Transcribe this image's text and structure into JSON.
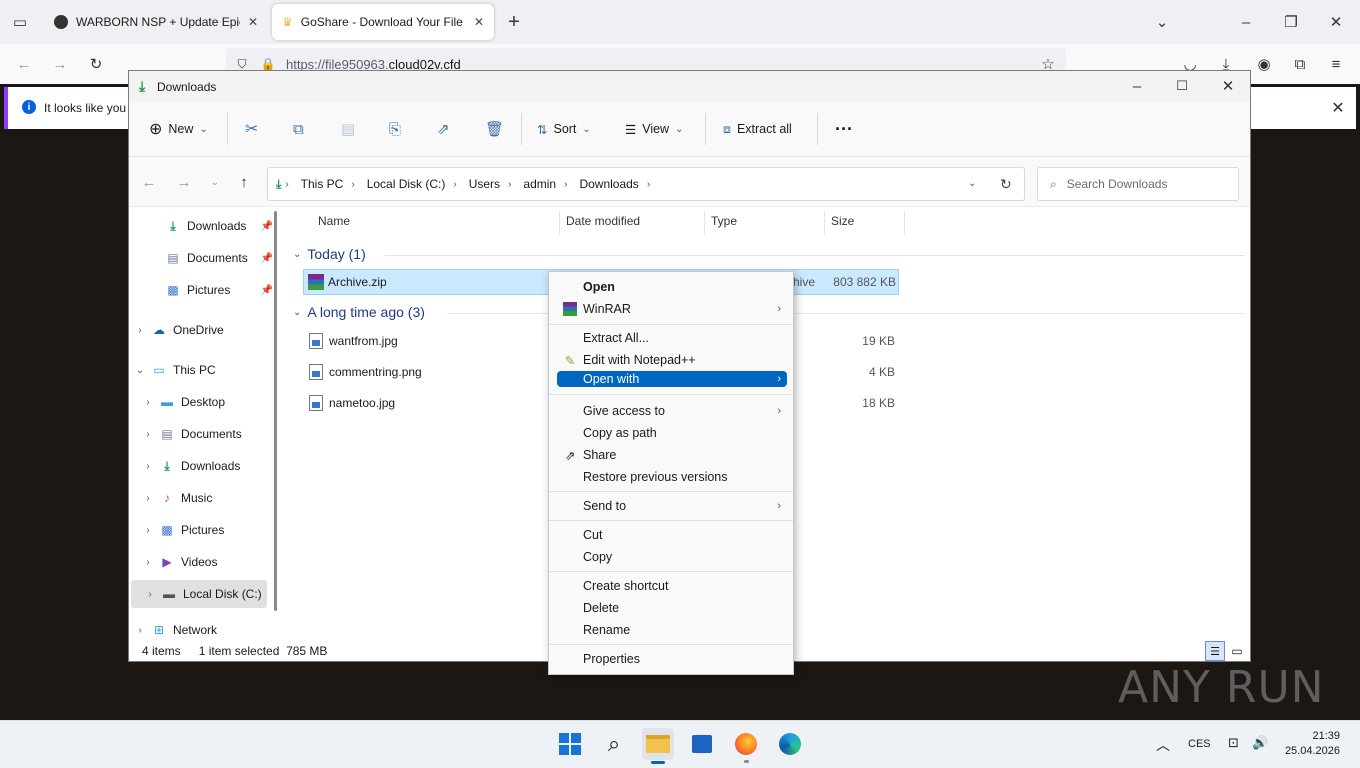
{
  "colors": {
    "accent": "#0067c0",
    "selection": "#cce8ff",
    "infobar_accent": "#8f3dfe"
  },
  "browser": {
    "tabs": [
      {
        "title": "WARBORN NSP + Update Epic N",
        "icon": "game-icon"
      },
      {
        "title": "GoShare - Download Your File",
        "icon": "crown-icon"
      }
    ],
    "url_prefix": "https://file950963.",
    "url_domain": "cloud02v.cfd",
    "infobar_text": "It looks like you h"
  },
  "explorer": {
    "title": "Downloads",
    "toolbar": {
      "new": "New",
      "sort": "Sort",
      "view": "View",
      "extract_all": "Extract all"
    },
    "breadcrumb": [
      "This PC",
      "Local Disk (C:)",
      "Users",
      "admin",
      "Downloads"
    ],
    "search_placeholder": "Search Downloads",
    "nav": {
      "quick": [
        {
          "label": "Downloads",
          "icon": "download-arrow-icon"
        },
        {
          "label": "Documents",
          "icon": "document-icon"
        },
        {
          "label": "Pictures",
          "icon": "picture-icon"
        }
      ],
      "onedrive": "OneDrive",
      "this_pc": "This PC",
      "pc_items": [
        "Desktop",
        "Documents",
        "Downloads",
        "Music",
        "Pictures",
        "Videos",
        "Local Disk (C:)"
      ],
      "network": "Network"
    },
    "columns": {
      "name": "Name",
      "date": "Date modified",
      "type": "Type",
      "size": "Size"
    },
    "groups": {
      "today": "Today (1)",
      "long_ago": "A long time ago (3)"
    },
    "files_today": [
      {
        "name": "Archive.zip",
        "type_partial": "hive",
        "size": "803 882 KB"
      }
    ],
    "files_old": [
      {
        "name": "wantfrom.jpg",
        "size": "19 KB"
      },
      {
        "name": "commentring.png",
        "size": "4 KB"
      },
      {
        "name": "nametoo.jpg",
        "size": "18 KB"
      }
    ],
    "status": {
      "items": "4 items",
      "selected": "1 item selected",
      "size": "785 MB"
    }
  },
  "context_menu": {
    "open": "Open",
    "winrar": "WinRAR",
    "extract_all": "Extract All...",
    "notepad": "Edit with Notepad++",
    "open_with": "Open with",
    "give_access": "Give access to",
    "copy_path": "Copy as path",
    "share": "Share",
    "restore": "Restore previous versions",
    "send_to": "Send to",
    "cut": "Cut",
    "copy": "Copy",
    "create_shortcut": "Create shortcut",
    "delete": "Delete",
    "rename": "Rename",
    "properties": "Properties"
  },
  "taskbar": {
    "language": "CES",
    "time": "21:39",
    "date": "25.04.2026"
  },
  "watermark": "ANY RUN"
}
